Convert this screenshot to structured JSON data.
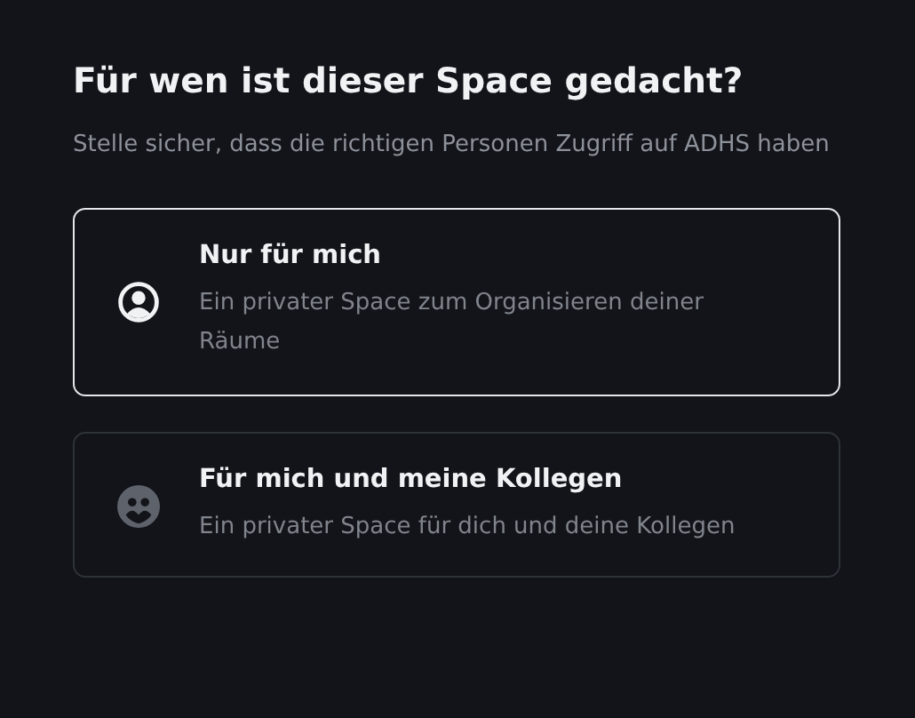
{
  "title": "Für wen ist dieser Space gedacht?",
  "subtitle": "Stelle sicher, dass die richtigen Personen Zugriff auf ADHS haben",
  "options": [
    {
      "kind": "single",
      "title": "Nur für mich",
      "description": "Ein privater Space zum Organisieren deiner Räume",
      "selected": true
    },
    {
      "kind": "team",
      "title": "Für mich und meine Kollegen",
      "description": "Ein privater Space für dich und deine Kollegen",
      "selected": false
    }
  ]
}
